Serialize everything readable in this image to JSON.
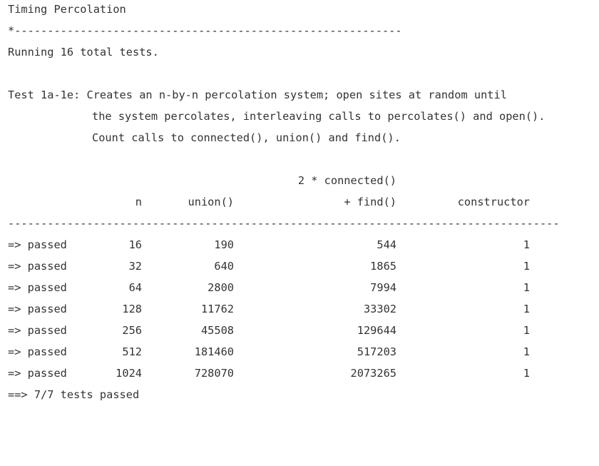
{
  "output": {
    "title": "Timing Percolation",
    "separator_short": "*-----------------------------------------------------------",
    "running": "Running 16 total tests.",
    "test_desc": [
      "Test 1a-1e: Creates an n-by-n percolation system; open sites at random until",
      "the system percolates, interleaving calls to percolates() and open().",
      "Count calls to connected(), union() and find()."
    ],
    "table": {
      "header_top": "2 * connected()",
      "headers": [
        "n",
        "union()",
        "+ find()",
        "constructor"
      ],
      "separator": "------------------------------------------------------------------------------------",
      "rows": [
        {
          "status": "=> passed",
          "n": "16",
          "union": "190",
          "find": "544",
          "ctor": "1"
        },
        {
          "status": "=> passed",
          "n": "32",
          "union": "640",
          "find": "1865",
          "ctor": "1"
        },
        {
          "status": "=> passed",
          "n": "64",
          "union": "2800",
          "find": "7994",
          "ctor": "1"
        },
        {
          "status": "=> passed",
          "n": "128",
          "union": "11762",
          "find": "33302",
          "ctor": "1"
        },
        {
          "status": "=> passed",
          "n": "256",
          "union": "45508",
          "find": "129644",
          "ctor": "1"
        },
        {
          "status": "=> passed",
          "n": "512",
          "union": "181460",
          "find": "517203",
          "ctor": "1"
        },
        {
          "status": "=> passed",
          "n": "1024",
          "union": "728070",
          "find": "2073265",
          "ctor": "1"
        }
      ]
    },
    "summary": "==> 7/7 tests passed"
  }
}
